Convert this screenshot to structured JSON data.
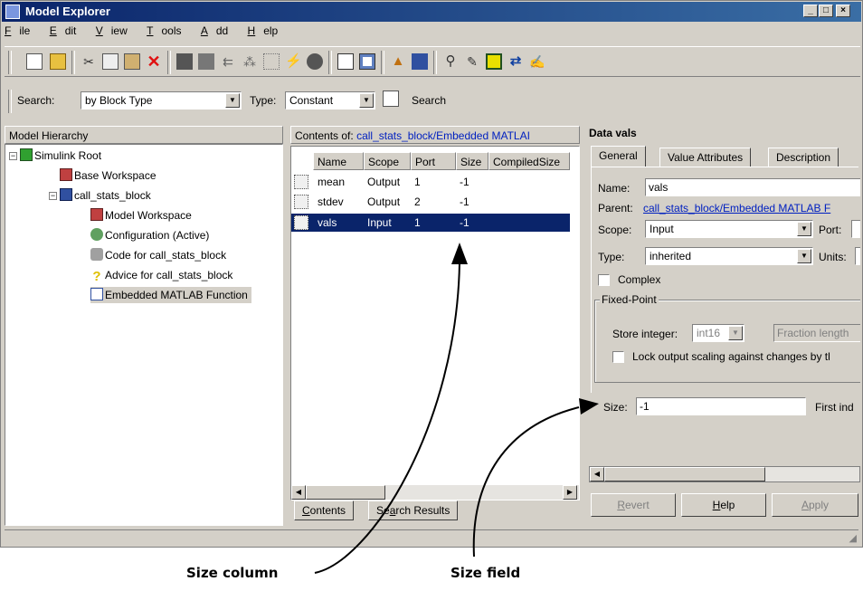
{
  "window": {
    "title": "Model Explorer",
    "controls": [
      "_",
      "□",
      "×"
    ]
  },
  "menu": [
    {
      "key": "F",
      "rest": "ile"
    },
    {
      "key": "E",
      "rest": "dit"
    },
    {
      "key": "V",
      "rest": "iew"
    },
    {
      "key": "T",
      "rest": "ools"
    },
    {
      "key": "A",
      "rest": "dd"
    },
    {
      "key": "H",
      "rest": "elp"
    }
  ],
  "searchbar": {
    "search_label": "Search:",
    "search_value": "by Block Type",
    "type_label": "Type:",
    "type_value": "Constant",
    "search_button": "Search"
  },
  "hierarchy": {
    "header": "Model Hierarchy",
    "items": [
      {
        "label": "Simulink Root",
        "icon": "simulink-root-icon"
      },
      {
        "label": "Base Workspace",
        "icon": "workspace-icon"
      },
      {
        "label": "call_stats_block",
        "icon": "model-icon"
      },
      {
        "label": "Model Workspace",
        "icon": "workspace-icon"
      },
      {
        "label": "Configuration (Active)",
        "icon": "configuration-icon"
      },
      {
        "label": "Code for call_stats_block",
        "icon": "code-icon"
      },
      {
        "label": "Advice for call_stats_block",
        "icon": "advice-icon"
      },
      {
        "label": "Embedded MATLAB Function",
        "icon": "embedded-matlab-icon"
      }
    ]
  },
  "contents": {
    "label": "Contents of:",
    "path": "call_stats_block/Embedded MATLAI",
    "columns": [
      "Name",
      "Scope",
      "Port",
      "Size",
      "CompiledSize"
    ],
    "rows": [
      {
        "name": "mean",
        "scope": "Output",
        "port": "1",
        "size": "-1"
      },
      {
        "name": "stdev",
        "scope": "Output",
        "port": "2",
        "size": "-1"
      },
      {
        "name": "vals",
        "scope": "Input",
        "port": "1",
        "size": "-1"
      }
    ],
    "tabs": [
      {
        "key": "C",
        "rest": "ontents"
      },
      {
        "pre": "Se",
        "key": "a",
        "rest": "rch Results"
      }
    ]
  },
  "dialog": {
    "title": "Data vals",
    "tabs": [
      "General",
      "Value Attributes",
      "Description"
    ],
    "name_label": "Name:",
    "name_value": "vals",
    "parent_label": "Parent:",
    "parent_value": "call_stats_block/Embedded MATLAB F",
    "scope_label": "Scope:",
    "scope_value": "Input",
    "port_label": "Port:",
    "type_label": "Type:",
    "type_value": "inherited",
    "units_label": "Units:",
    "complex_label": "Complex",
    "fixed_point_label": "Fixed-Point",
    "store_integer_label": "Store integer:",
    "store_integer_value": "int16",
    "fraction_length_value": "Fraction length",
    "lock_label": "Lock output scaling against changes by tl",
    "size_label": "Size:",
    "size_value": "-1",
    "first_index_label": "First ind",
    "buttons": [
      {
        "key": "R",
        "rest": "evert"
      },
      {
        "key": "H",
        "rest": "elp"
      },
      {
        "key": "A",
        "rest": "pply"
      }
    ]
  },
  "callouts": {
    "size_column": "Size column",
    "size_field": "Size field"
  }
}
